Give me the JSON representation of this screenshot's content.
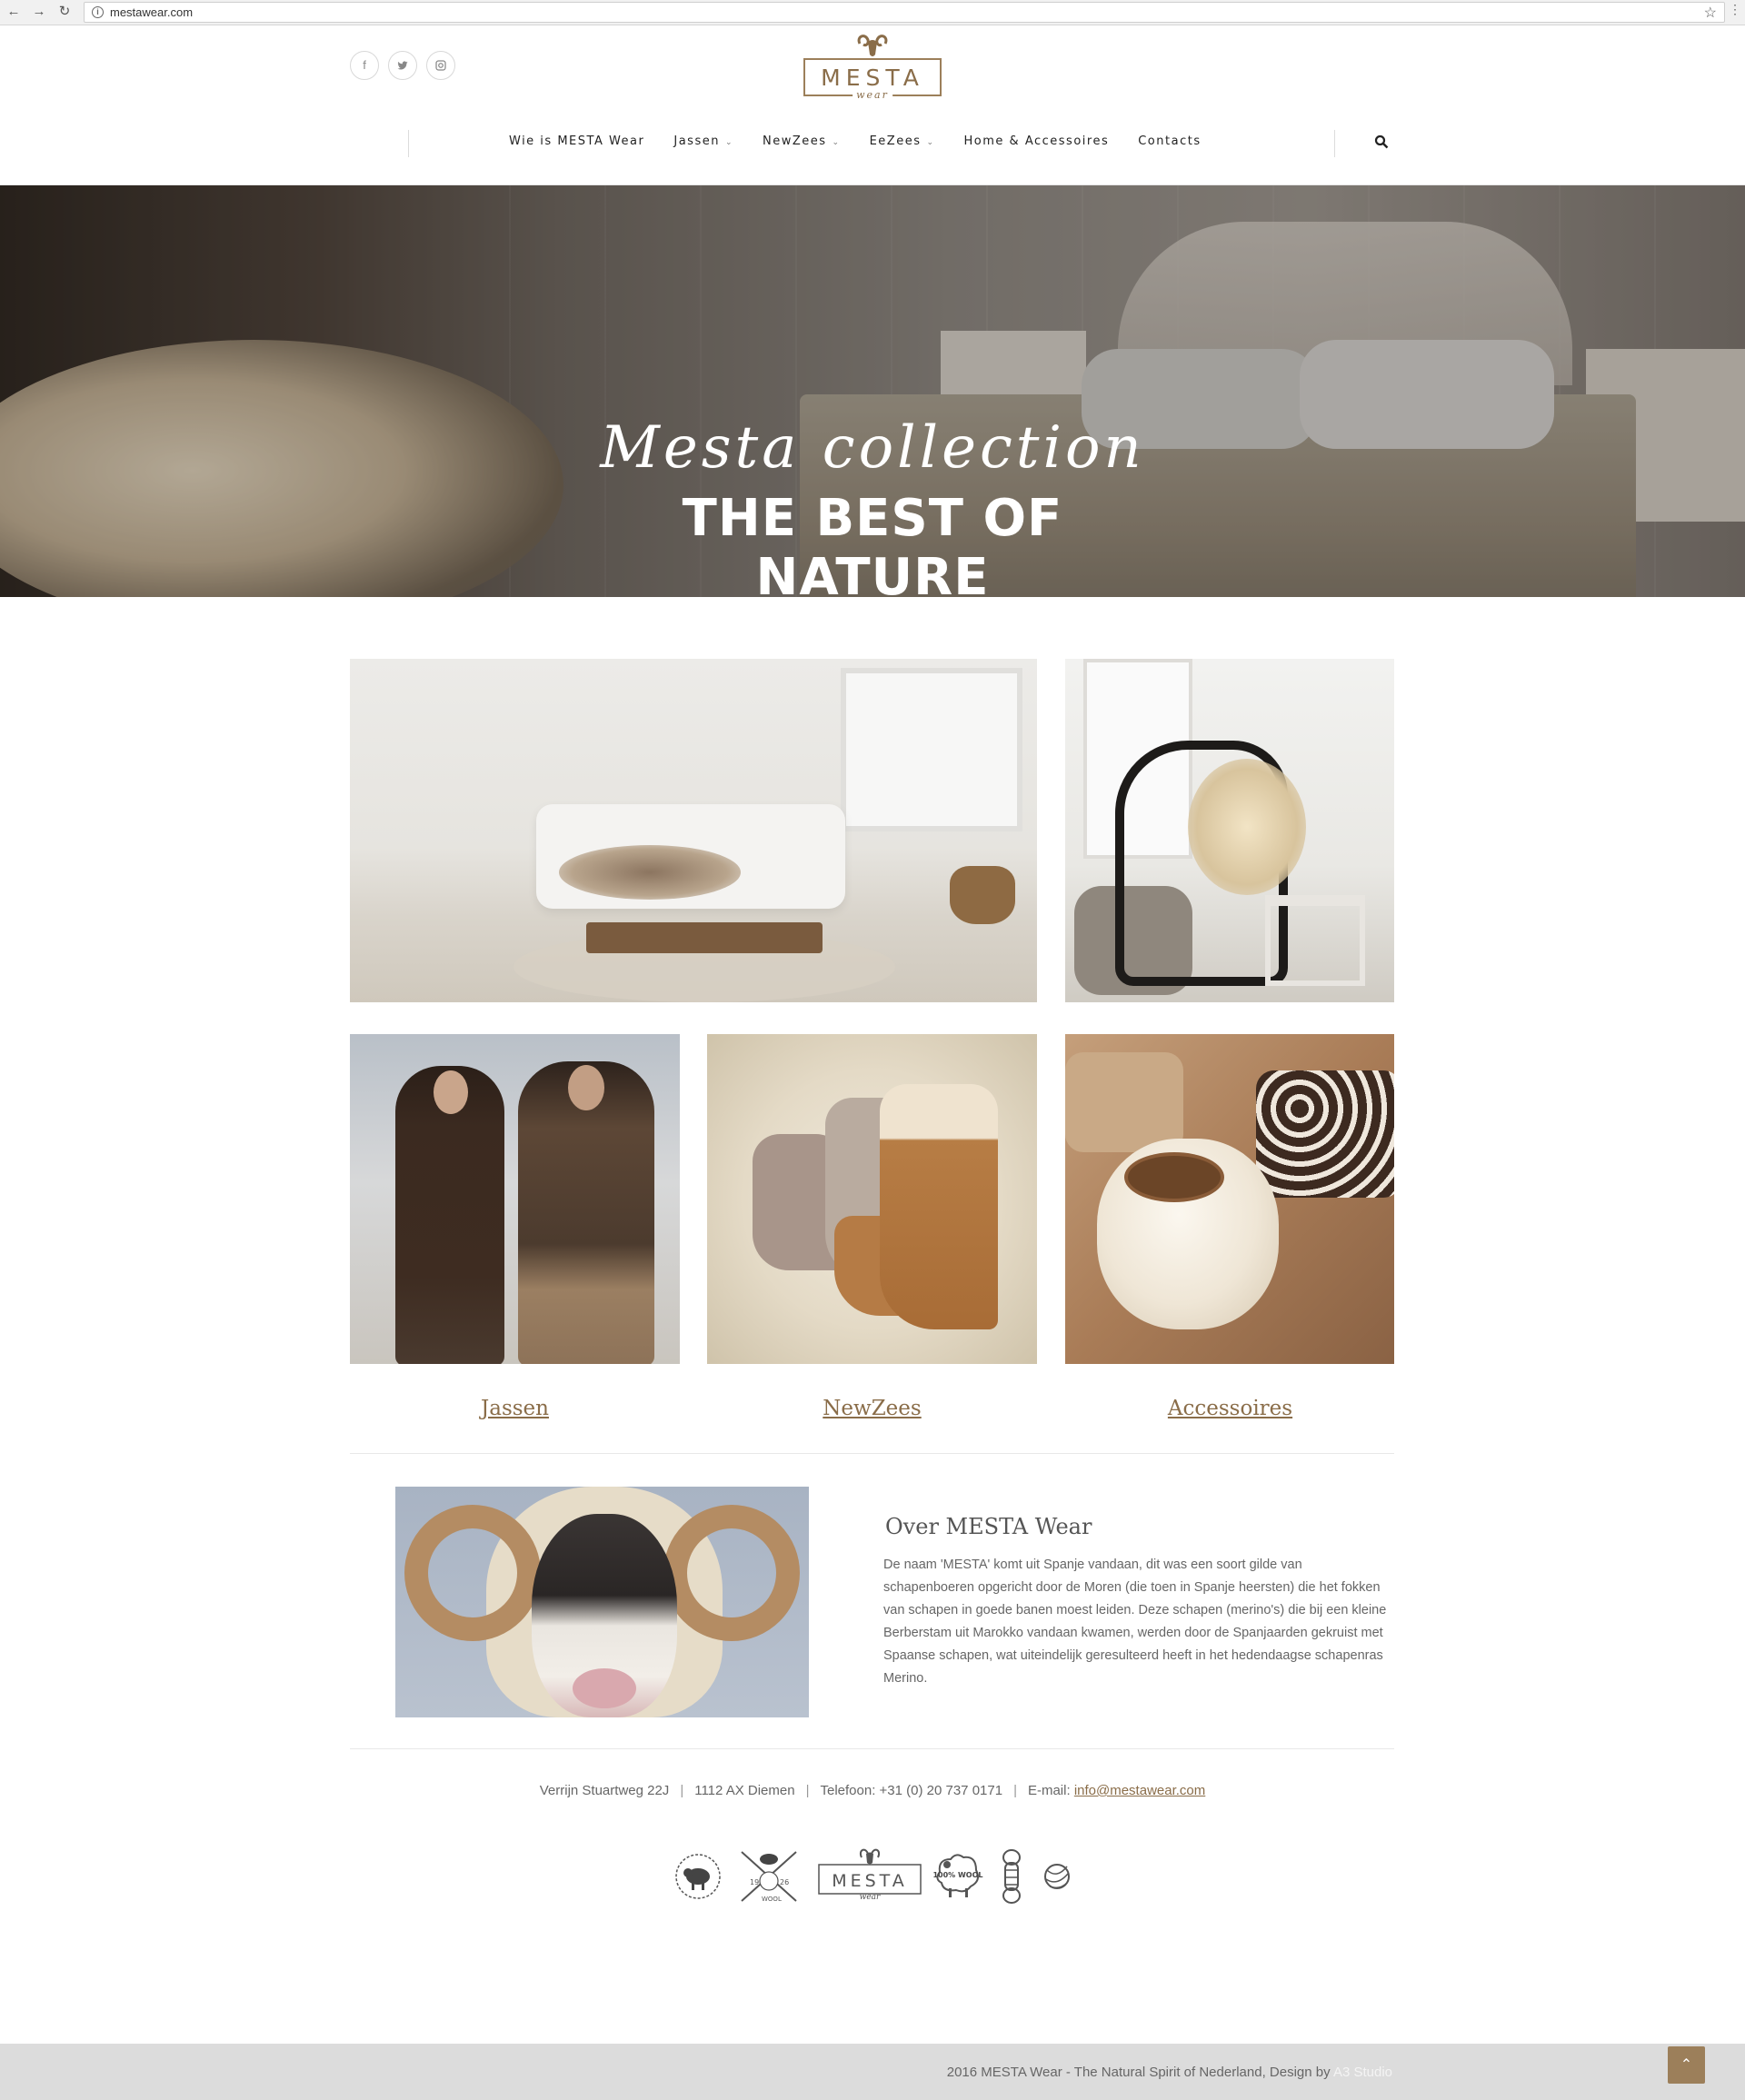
{
  "browser": {
    "url": "mestawear.com"
  },
  "header": {
    "logo_text": "MESTA",
    "logo_sub": "wear",
    "social": [
      {
        "icon": "facebook-icon",
        "glyph": "f"
      },
      {
        "icon": "twitter-icon",
        "glyph": "t"
      },
      {
        "icon": "instagram-icon",
        "glyph": "◙"
      }
    ],
    "nav": [
      {
        "label": "Wie is MESTA Wear",
        "dropdown": false
      },
      {
        "label": "Jassen",
        "dropdown": true
      },
      {
        "label": "NewZees",
        "dropdown": true
      },
      {
        "label": "EeZees",
        "dropdown": true
      },
      {
        "label": "Home & Accessoires",
        "dropdown": false
      },
      {
        "label": "Contacts",
        "dropdown": false
      }
    ],
    "search_icon": "search-icon"
  },
  "hero": {
    "script": "Mesta collection",
    "headline": "THE BEST OF NATURE"
  },
  "categories": [
    {
      "label": "Jassen"
    },
    {
      "label": "NewZees"
    },
    {
      "label": "Accessoires"
    }
  ],
  "about": {
    "title": "Over MESTA Wear",
    "text": "De naam 'MESTA' komt uit Spanje vandaan, dit was een soort gilde van schapenboeren opgericht door de Moren (die toen in Spanje heersten) die het fokken van schapen in goede banen moest leiden. Deze schapen (merino's) die bij een kleine Berberstam uit Marokko vandaan kwamen, werden door de Spanjaarden gekruist met Spaanse schapen, wat uiteindelijk geresulteerd heeft in het hedendaagse schapenras Merino."
  },
  "contact": {
    "street": "Verrijn Stuartweg 22J",
    "city": "1112 AX  Diemen",
    "phone": "Telefoon: +31 (0) 20 737 0171",
    "email_label": "E-mail:",
    "email": "info@mestawear.com"
  },
  "badges": {
    "b2_year_left": "19",
    "b2_year_right": "26",
    "b2_text": "WOOL",
    "logo_text": "MESTA",
    "logo_sub": "wear",
    "b4_text": "100% WOOL"
  },
  "footer": {
    "text": "2016 MESTA Wear - The Natural Spirit of Nederland, Design by ",
    "studio": "A3 Studio",
    "to_top": "⌃"
  },
  "colors": {
    "accent": "#9c7f5a",
    "footer_bg": "#dcdcdc"
  }
}
